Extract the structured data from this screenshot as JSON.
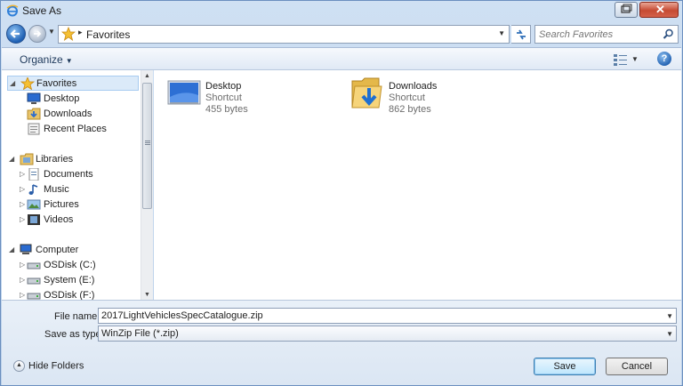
{
  "window": {
    "title": "Save As",
    "close_glyph": "✕"
  },
  "address": {
    "crumb": "Favorites",
    "separator": "▸"
  },
  "search": {
    "placeholder": "Search Favorites"
  },
  "toolbar": {
    "organize_label": "Organize",
    "help_glyph": "?"
  },
  "sidebar": {
    "favorites": {
      "label": "Favorites",
      "items": [
        {
          "label": "Desktop",
          "icon": "desktop-icon"
        },
        {
          "label": "Downloads",
          "icon": "downloads-icon"
        },
        {
          "label": "Recent Places",
          "icon": "recent-places-icon"
        }
      ]
    },
    "libraries": {
      "label": "Libraries",
      "items": [
        {
          "label": "Documents",
          "icon": "documents-icon"
        },
        {
          "label": "Music",
          "icon": "music-icon"
        },
        {
          "label": "Pictures",
          "icon": "pictures-icon"
        },
        {
          "label": "Videos",
          "icon": "videos-icon"
        }
      ]
    },
    "computer": {
      "label": "Computer",
      "items": [
        {
          "label": "OSDisk (C:)",
          "icon": "drive-icon"
        },
        {
          "label": "System (E:)",
          "icon": "drive-icon"
        },
        {
          "label": "OSDisk (F:)",
          "icon": "drive-icon"
        }
      ]
    }
  },
  "files": [
    {
      "name": "Desktop",
      "type": "Shortcut",
      "size": "455 bytes",
      "icon": "desktop-shortcut-icon"
    },
    {
      "name": "Downloads",
      "type": "Shortcut",
      "size": "862 bytes",
      "icon": "downloads-folder-icon"
    }
  ],
  "form": {
    "filename_label": "File name:",
    "filename_value": "2017LightVehiclesSpecCatalogue.zip",
    "type_label": "Save as type:",
    "type_value": "WinZip File (*.zip)"
  },
  "footer": {
    "hide_folders_label": "Hide Folders",
    "save_label": "Save",
    "cancel_label": "Cancel"
  },
  "colors": {
    "accent": "#1d5fb3",
    "selection": "#dbeaf9",
    "close": "#c64b33"
  }
}
